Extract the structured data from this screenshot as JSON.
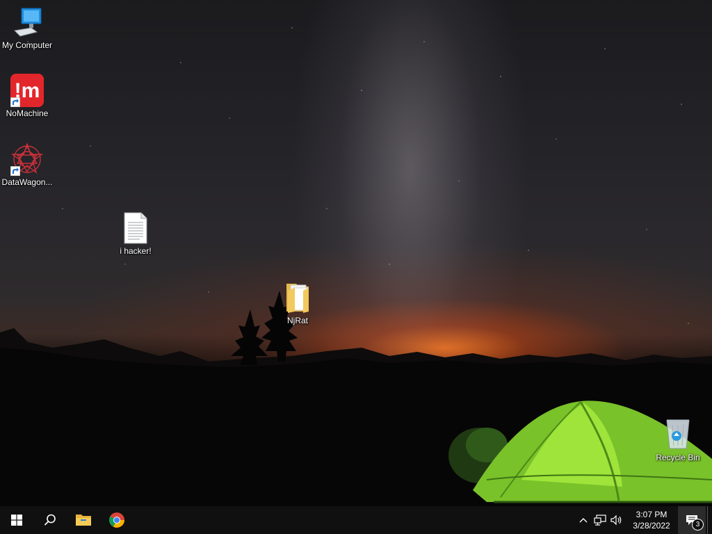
{
  "desktop": {
    "icons": [
      {
        "label": "My Computer",
        "icon": "computer-icon"
      },
      {
        "label": "NoMachine",
        "icon": "nomachine-icon"
      },
      {
        "label": "DataWagon...",
        "icon": "datawagon-icon"
      },
      {
        "label": "i hacker!",
        "icon": "text-document-icon"
      },
      {
        "label": "NjRat",
        "icon": "folder-icon"
      },
      {
        "label": "Recycle Bin",
        "icon": "recycle-bin-icon"
      }
    ],
    "nomachine_logo_text": "!m"
  },
  "taskbar": {
    "start": {
      "icon": "windows-logo-icon"
    },
    "search": {
      "icon": "search-icon"
    },
    "pinned": [
      {
        "name": "File Explorer",
        "icon": "file-explorer-icon"
      },
      {
        "name": "Google Chrome",
        "icon": "chrome-icon"
      }
    ],
    "tray": {
      "icons": [
        "chevron-up-icon",
        "network-icon",
        "volume-icon"
      ],
      "time": "3:07 PM",
      "date": "3/28/2022",
      "notification_count": "3"
    }
  },
  "colors": {
    "taskbar_bg": "#101010",
    "tent_green": "#8fdc2a",
    "horizon_glow": "#ff7a1e",
    "nomachine_red": "#e3262b"
  }
}
